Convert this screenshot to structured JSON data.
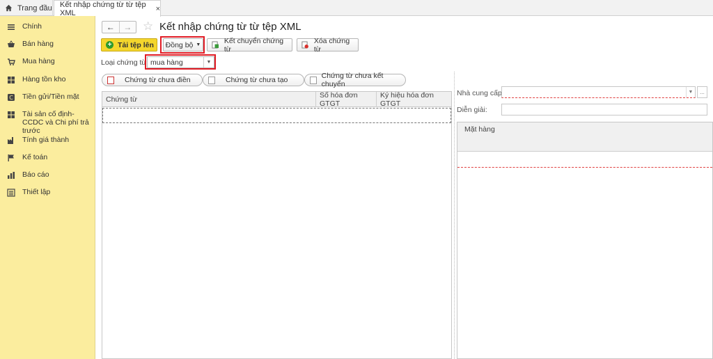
{
  "tabs": {
    "home_label": "Trang đầu",
    "doc_label": "Kết nhập chứng từ từ tệp XML",
    "close": "×"
  },
  "sidebar": {
    "items": [
      {
        "label": "Chính",
        "icon": "menu-icon"
      },
      {
        "label": "Bán hàng",
        "icon": "basket-icon"
      },
      {
        "label": "Mua hàng",
        "icon": "cart-icon"
      },
      {
        "label": "Hàng tồn kho",
        "icon": "warehouse-icon"
      },
      {
        "label": "Tiền gửi/Tiền mặt",
        "icon": "cash-icon"
      },
      {
        "label": "Tài sản cố định-CCDC và Chi phí trả trước",
        "icon": "assets-icon"
      },
      {
        "label": "Tính giá thành",
        "icon": "factory-icon"
      },
      {
        "label": "Kế toán",
        "icon": "flag-icon"
      },
      {
        "label": "Báo cáo",
        "icon": "bar-chart-icon"
      },
      {
        "label": "Thiết lập",
        "icon": "settings-list-icon"
      }
    ]
  },
  "header": {
    "back": "←",
    "forward": "→",
    "title": "Kết nhập chứng từ từ tệp XML"
  },
  "toolbar": {
    "upload_label": "Tải tệp lên",
    "sync_label": "Đồng bộ",
    "transfer_label": "Kết chuyển chứng từ",
    "delete_label": "Xóa chứng từ"
  },
  "doctype": {
    "label": "Loại chứng từ:",
    "value": "mua hàng"
  },
  "filters": {
    "unfilled": "Chứng từ chưa điền",
    "uncreated": "Chứng từ chưa tạo",
    "untransferred": "Chứng từ chưa kết chuyển"
  },
  "grid": {
    "columns": [
      "Chứng từ",
      "Số hóa đơn GTGT",
      "Ký hiệu hóa đơn GTGT"
    ]
  },
  "detail": {
    "supplier_label": "Nhà cung cấp:",
    "supplier_more": "...",
    "description_label": "Diễn giải:",
    "items_header": "Mặt hàng"
  },
  "colors": {
    "sidebar_bg": "#fbed9e",
    "upload_btn": "#f4d62d",
    "highlight": "#e01b24"
  }
}
